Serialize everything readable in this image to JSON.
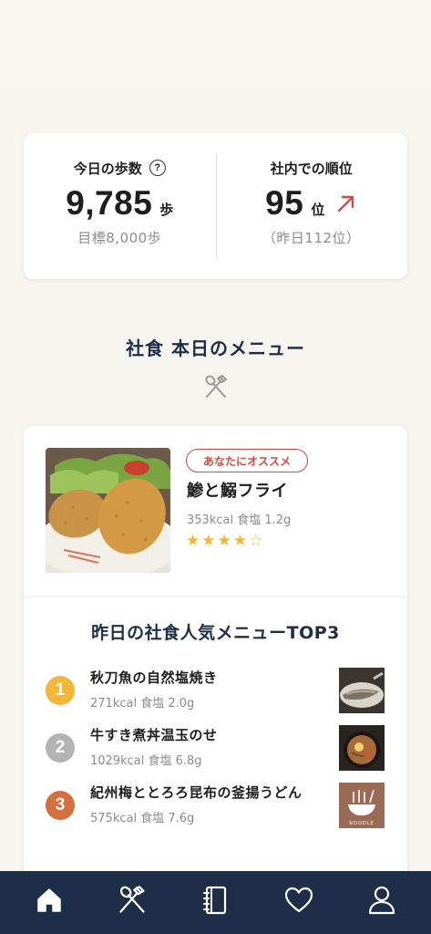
{
  "stats": {
    "steps_label": "今日の歩数",
    "help_glyph": "?",
    "steps_value": "9,785",
    "steps_unit": "歩",
    "steps_goal": "目標8,000歩",
    "rank_label": "社内での順位",
    "rank_value": "95",
    "rank_unit": "位",
    "rank_prev": "（昨日112位）",
    "rank_trend_icon": "arrow-up-right-icon",
    "rank_trend_color": "#d54a43"
  },
  "section": {
    "title": "社食 本日のメニュー",
    "icon": "utensils-icon"
  },
  "featured": {
    "badge": "あなたにオススメ",
    "name": "鯵と鰯フライ",
    "meta": "353kcal 食塩 1.2g",
    "rating": 4,
    "rating_max": 5
  },
  "top3": {
    "title": "昨日の社食人気メニューTOP3",
    "items": [
      {
        "rank": "1",
        "name": "秋刀魚の自然塩焼き",
        "meta": "271kcal 食塩 2.0g",
        "color": "#f4b63a"
      },
      {
        "rank": "2",
        "name": "牛すき煮丼温玉のせ",
        "meta": "1029kcal 食塩 6.8g",
        "color": "#b3b3b3"
      },
      {
        "rank": "3",
        "name": "紀州梅ととろろ昆布の釜揚うどん",
        "meta": "575kcal 食塩 7.6g",
        "color": "#d4703f"
      }
    ],
    "noodle_label": "NOODLE"
  },
  "nav": {
    "items": [
      "home-icon",
      "utensils-icon",
      "notebook-icon",
      "heart-icon",
      "user-icon"
    ]
  },
  "colors": {
    "navy": "#1e2d48",
    "accent_red": "#d54a43",
    "star": "#f4b63a",
    "background": "#f7f5f0"
  }
}
